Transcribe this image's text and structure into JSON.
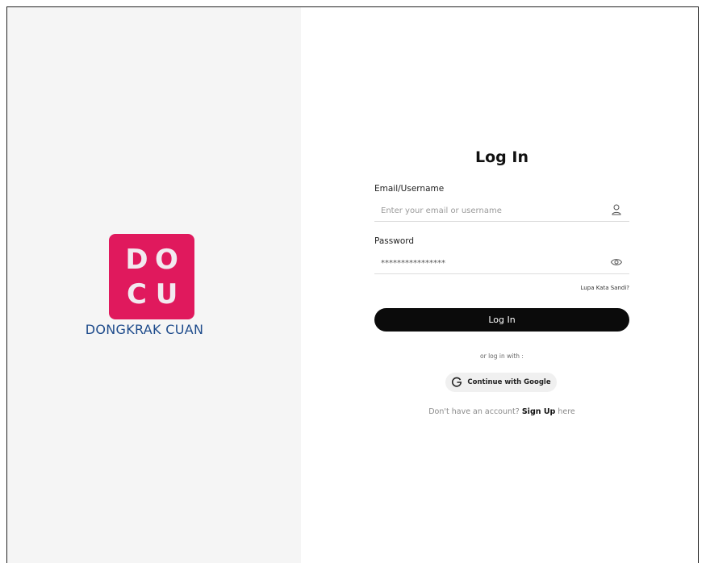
{
  "brand": {
    "logo_letters": [
      "D",
      "O",
      "C",
      "U"
    ],
    "name": "DONGKRAK CUAN",
    "logo_color": "#e0195d",
    "name_color": "#1f4c8c"
  },
  "login": {
    "title": "Log In",
    "email": {
      "label": "Email/Username",
      "placeholder": "Enter your email or username",
      "icon": "user-icon"
    },
    "password": {
      "label": "Password",
      "value": "****************",
      "icon": "eye-icon"
    },
    "forgot_label": "Lupa Kata Sandi?",
    "submit_label": "Log In",
    "or_text": "or log in with :",
    "google_label": "Continue with Google",
    "google_icon": "google-icon",
    "signup": {
      "prefix": "Don't have an account?",
      "link": "Sign Up",
      "suffix": "here"
    }
  }
}
